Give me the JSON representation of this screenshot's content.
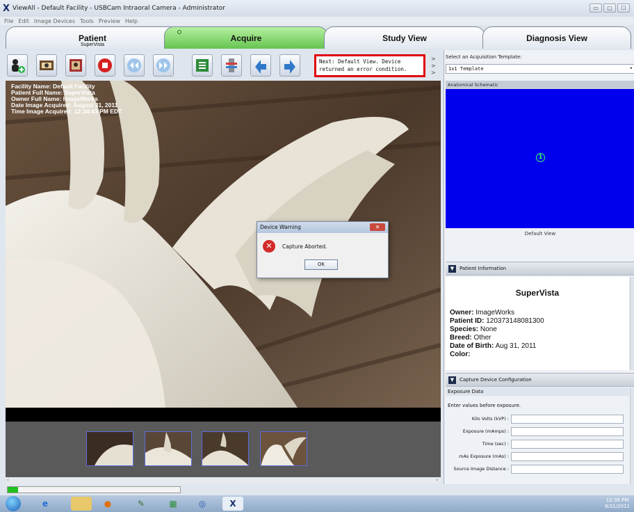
{
  "window": {
    "title": "ViewAll - Default Facility - USBCam Intraoral Camera - Administrator",
    "controls": [
      "▭",
      "▢",
      "☐"
    ]
  },
  "menu": [
    "File",
    "Edit",
    "Image Devices",
    "Tools",
    "Preview",
    "Help"
  ],
  "tabs": [
    {
      "label": "Patient",
      "sub": "SuperVista"
    },
    {
      "label": "Acquire",
      "sub": ""
    },
    {
      "label": "Study View",
      "sub": ""
    },
    {
      "label": "Diagnosis View",
      "sub": ""
    }
  ],
  "status_message": "Next: Default View.  Device returned an error condition.",
  "right_panel": {
    "acq_label": "Select an Acquisition Template:",
    "template_value": "1x1 Template",
    "schematic_header": "Anatomical Schematic",
    "schematic_marker": "1",
    "schematic_caption": "Default View",
    "patient_info_header": "Patient Information",
    "patient": {
      "name": "SuperVista",
      "owner_label": "Owner:",
      "owner": "ImageWorks",
      "id_label": "Patient ID:",
      "id": "120373148081300",
      "species_label": "Species:",
      "species": "None",
      "breed_label": "Breed:",
      "breed": "Other",
      "dob_label": "Date of Birth:",
      "dob": "Aug 31, 2011",
      "color_label": "Color:",
      "color": ""
    },
    "capture_header": "Capture Device Configuration",
    "exposure_header": "Exposure Data",
    "exposure_note": "Enter values before exposure.",
    "fields": [
      "Kilo Volts (kVP) :",
      "Exposure (mAmps) :",
      "Time (sec) :",
      "mAs Exposure (mAs) :",
      "Source Image Distance :"
    ]
  },
  "overlay": {
    "facility": "Facility Name: Default Facility",
    "patient": "Patient Full Name: SuperVista",
    "owner": "Owner Full Name: ImageWorks",
    "date": "Date Image Acquired: August 31, 2011",
    "time": "Time Image Acquired: 12:34:43 PM EDT"
  },
  "dialog": {
    "title": "Device Warning",
    "message": "Capture Aborted.",
    "ok": "OK"
  },
  "progress": {
    "fraction": 0.06
  },
  "tray": {
    "time": "12:38 PM",
    "date": "8/31/2011"
  },
  "colors": {
    "active_tab": "#66c450",
    "schematic_bg": "#0000ee",
    "status_border": "#e0000a"
  }
}
